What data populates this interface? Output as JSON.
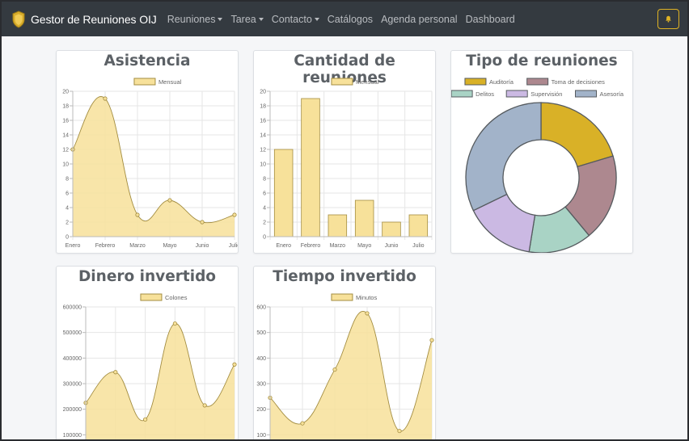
{
  "nav": {
    "brand": "Gestor de Reuniones OIJ",
    "items": [
      {
        "label": "Reuniones",
        "dropdown": true
      },
      {
        "label": "Tarea",
        "dropdown": true
      },
      {
        "label": "Contacto",
        "dropdown": true
      },
      {
        "label": "Catálogos",
        "dropdown": false
      },
      {
        "label": "Agenda personal",
        "dropdown": false
      },
      {
        "label": "Dashboard",
        "dropdown": false
      }
    ],
    "bell_icon": "bell-icon",
    "accent": "#e0b324"
  },
  "cards": {
    "asistencia": {
      "title": "Asistencia"
    },
    "cantidad": {
      "title": "Cantidad de reuniones"
    },
    "tipo": {
      "title": "Tipo de reuniones"
    },
    "dinero": {
      "title": "Dinero invertido"
    },
    "tiempo": {
      "title": "Tiempo invertido"
    }
  },
  "chart_data": [
    {
      "id": "asistencia",
      "type": "line",
      "title": "Asistencia",
      "categories": [
        "Enero",
        "Febrero",
        "Marzo",
        "Mayo",
        "Junio",
        "Julio"
      ],
      "series": [
        {
          "name": "Mensual",
          "values": [
            12,
            19,
            3,
            5,
            2,
            3
          ]
        }
      ],
      "ylim": [
        0,
        20
      ],
      "yticks": [
        0,
        2,
        4,
        6,
        8,
        10,
        12,
        14,
        16,
        18,
        20
      ],
      "fill": "#f7e19a",
      "stroke": "#a38d41",
      "grid": true,
      "legend": "top"
    },
    {
      "id": "cantidad",
      "type": "bar",
      "title": "Cantidad de reuniones",
      "categories": [
        "Enero",
        "Febrero",
        "Marzo",
        "Mayo",
        "Junio",
        "Julio"
      ],
      "series": [
        {
          "name": "Mensual",
          "values": [
            12,
            19,
            3,
            5,
            2,
            3
          ]
        }
      ],
      "ylim": [
        0,
        20
      ],
      "yticks": [
        0,
        2,
        4,
        6,
        8,
        10,
        12,
        14,
        16,
        18,
        20
      ],
      "fill": "#f7e19a",
      "stroke": "#a38d41",
      "grid": true,
      "legend": "top"
    },
    {
      "id": "tipo",
      "type": "pie",
      "title": "Tipo de reuniones",
      "categories": [
        "Auditoría",
        "Toma de decisiones",
        "Delitos",
        "Supervisión",
        "Asesoría"
      ],
      "values": [
        12,
        11,
        8,
        9,
        19
      ],
      "colors": [
        "#d9b127",
        "#ad888f",
        "#a9d3c5",
        "#cbb9e3",
        "#a2b3c9"
      ],
      "stroke": "#555a5e",
      "legend": "top"
    },
    {
      "id": "dinero",
      "type": "line",
      "title": "Dinero invertido",
      "x": [
        0,
        1,
        2,
        3,
        4,
        5
      ],
      "series": [
        {
          "name": "Colones",
          "values": [
            225000,
            345000,
            160000,
            535000,
            215000,
            375000
          ]
        }
      ],
      "ylim": [
        0,
        600000
      ],
      "yticks": [
        100000,
        200000,
        300000,
        400000,
        500000,
        600000
      ],
      "fill": "#f7e19a",
      "stroke": "#a38d41",
      "grid": true,
      "legend": "top"
    },
    {
      "id": "tiempo",
      "type": "line",
      "title": "Tiempo invertido",
      "x": [
        0,
        1,
        2,
        3,
        4,
        5
      ],
      "series": [
        {
          "name": "Minutos",
          "values": [
            245,
            145,
            355,
            575,
            115,
            470
          ]
        }
      ],
      "ylim": [
        0,
        600
      ],
      "yticks": [
        100,
        200,
        300,
        400,
        500,
        600
      ],
      "fill": "#f7e19a",
      "stroke": "#a38d41",
      "grid": true,
      "legend": "top"
    }
  ]
}
